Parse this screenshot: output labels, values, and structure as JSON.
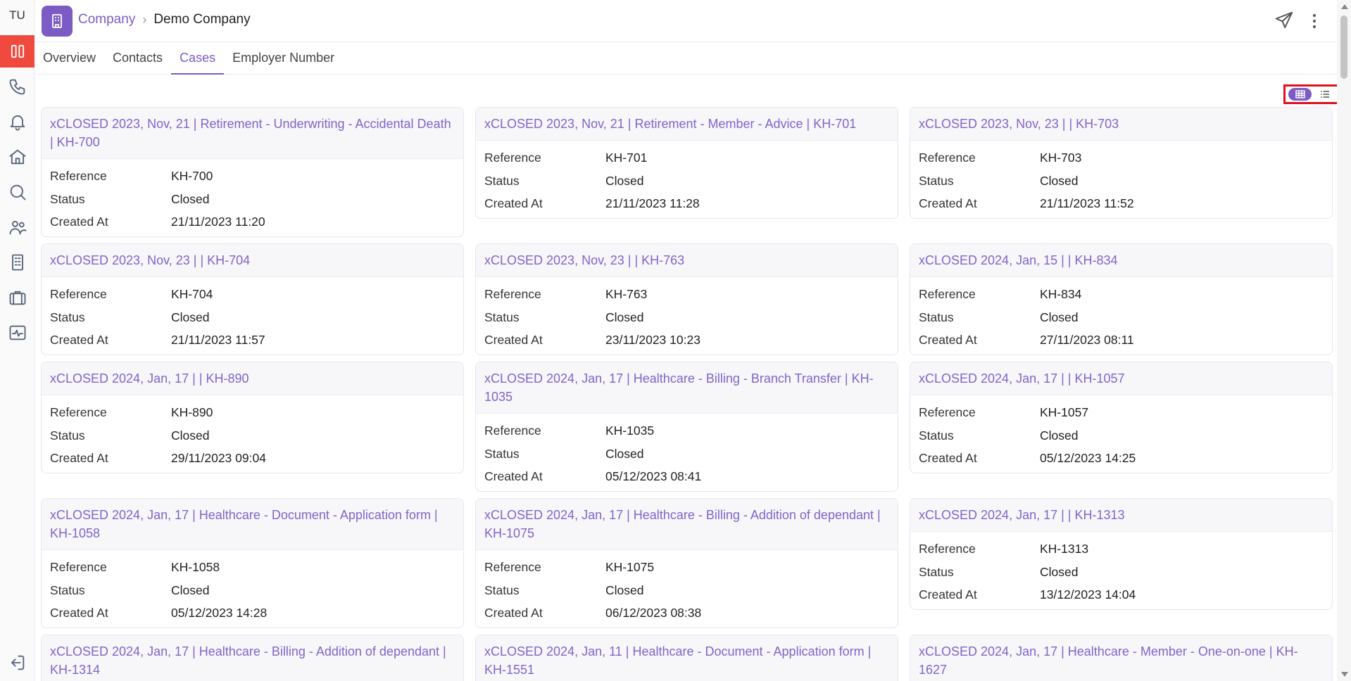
{
  "user_initials": "TU",
  "breadcrumb": {
    "parent": "Company",
    "current": "Demo Company"
  },
  "tabs": [
    {
      "label": "Overview",
      "active": false
    },
    {
      "label": "Contacts",
      "active": false
    },
    {
      "label": "Cases",
      "active": true
    },
    {
      "label": "Employer Number",
      "active": false
    }
  ],
  "sidebar_icons": [
    "columns-icon",
    "phone-icon",
    "bell-icon",
    "home-icon",
    "search-icon",
    "users-icon",
    "building-icon",
    "briefcase-icon",
    "activity-icon"
  ],
  "view_toggle": {
    "selected": "grid",
    "options": [
      "grid-icon",
      "list-icon"
    ]
  },
  "field_labels": {
    "reference": "Reference",
    "status": "Status",
    "created_at": "Created At"
  },
  "colors": {
    "accent": "#7c5cc4",
    "active_rail": "#f04a3e",
    "highlight_box": "#e0101f"
  },
  "cases": [
    {
      "title": "xCLOSED 2023, Nov, 21 | Retirement - Underwriting - Accidental Death | KH-700",
      "reference": "KH-700",
      "status": "Closed",
      "created_at": "21/11/2023 11:20"
    },
    {
      "title": "xCLOSED 2023, Nov, 21 | Retirement - Member - Advice | KH-701",
      "reference": "KH-701",
      "status": "Closed",
      "created_at": "21/11/2023 11:28"
    },
    {
      "title": "xCLOSED 2023, Nov, 23 | | KH-703",
      "reference": "KH-703",
      "status": "Closed",
      "created_at": "21/11/2023 11:52"
    },
    {
      "title": "xCLOSED 2023, Nov, 23 | | KH-704",
      "reference": "KH-704",
      "status": "Closed",
      "created_at": "21/11/2023 11:57"
    },
    {
      "title": "xCLOSED 2023, Nov, 23 | | KH-763",
      "reference": "KH-763",
      "status": "Closed",
      "created_at": "23/11/2023 10:23"
    },
    {
      "title": "xCLOSED 2024, Jan, 15 | | KH-834",
      "reference": "KH-834",
      "status": "Closed",
      "created_at": "27/11/2023 08:11"
    },
    {
      "title": "xCLOSED 2024, Jan, 17 | | KH-890",
      "reference": "KH-890",
      "status": "Closed",
      "created_at": "29/11/2023 09:04"
    },
    {
      "title": "xCLOSED 2024, Jan, 17 | Healthcare - Billing - Branch Transfer | KH-1035",
      "reference": "KH-1035",
      "status": "Closed",
      "created_at": "05/12/2023 08:41"
    },
    {
      "title": "xCLOSED 2024, Jan, 17 | | KH-1057",
      "reference": "KH-1057",
      "status": "Closed",
      "created_at": "05/12/2023 14:25"
    },
    {
      "title": "xCLOSED 2024, Jan, 17 | Healthcare - Document - Application form | KH-1058",
      "reference": "KH-1058",
      "status": "Closed",
      "created_at": "05/12/2023 14:28"
    },
    {
      "title": "xCLOSED 2024, Jan, 17 | Healthcare - Billing - Addition of dependant | KH-1075",
      "reference": "KH-1075",
      "status": "Closed",
      "created_at": "06/12/2023 08:38"
    },
    {
      "title": "xCLOSED 2024, Jan, 17 | | KH-1313",
      "reference": "KH-1313",
      "status": "Closed",
      "created_at": "13/12/2023 14:04"
    },
    {
      "title": "xCLOSED 2024, Jan, 17 | Healthcare - Billing - Addition of dependant | KH-1314"
    },
    {
      "title": "xCLOSED 2024, Jan, 11 | Healthcare - Document - Application form | KH-1551"
    },
    {
      "title": "xCLOSED 2024, Jan, 17 | Healthcare - Member - One-on-one | KH-1627"
    }
  ]
}
